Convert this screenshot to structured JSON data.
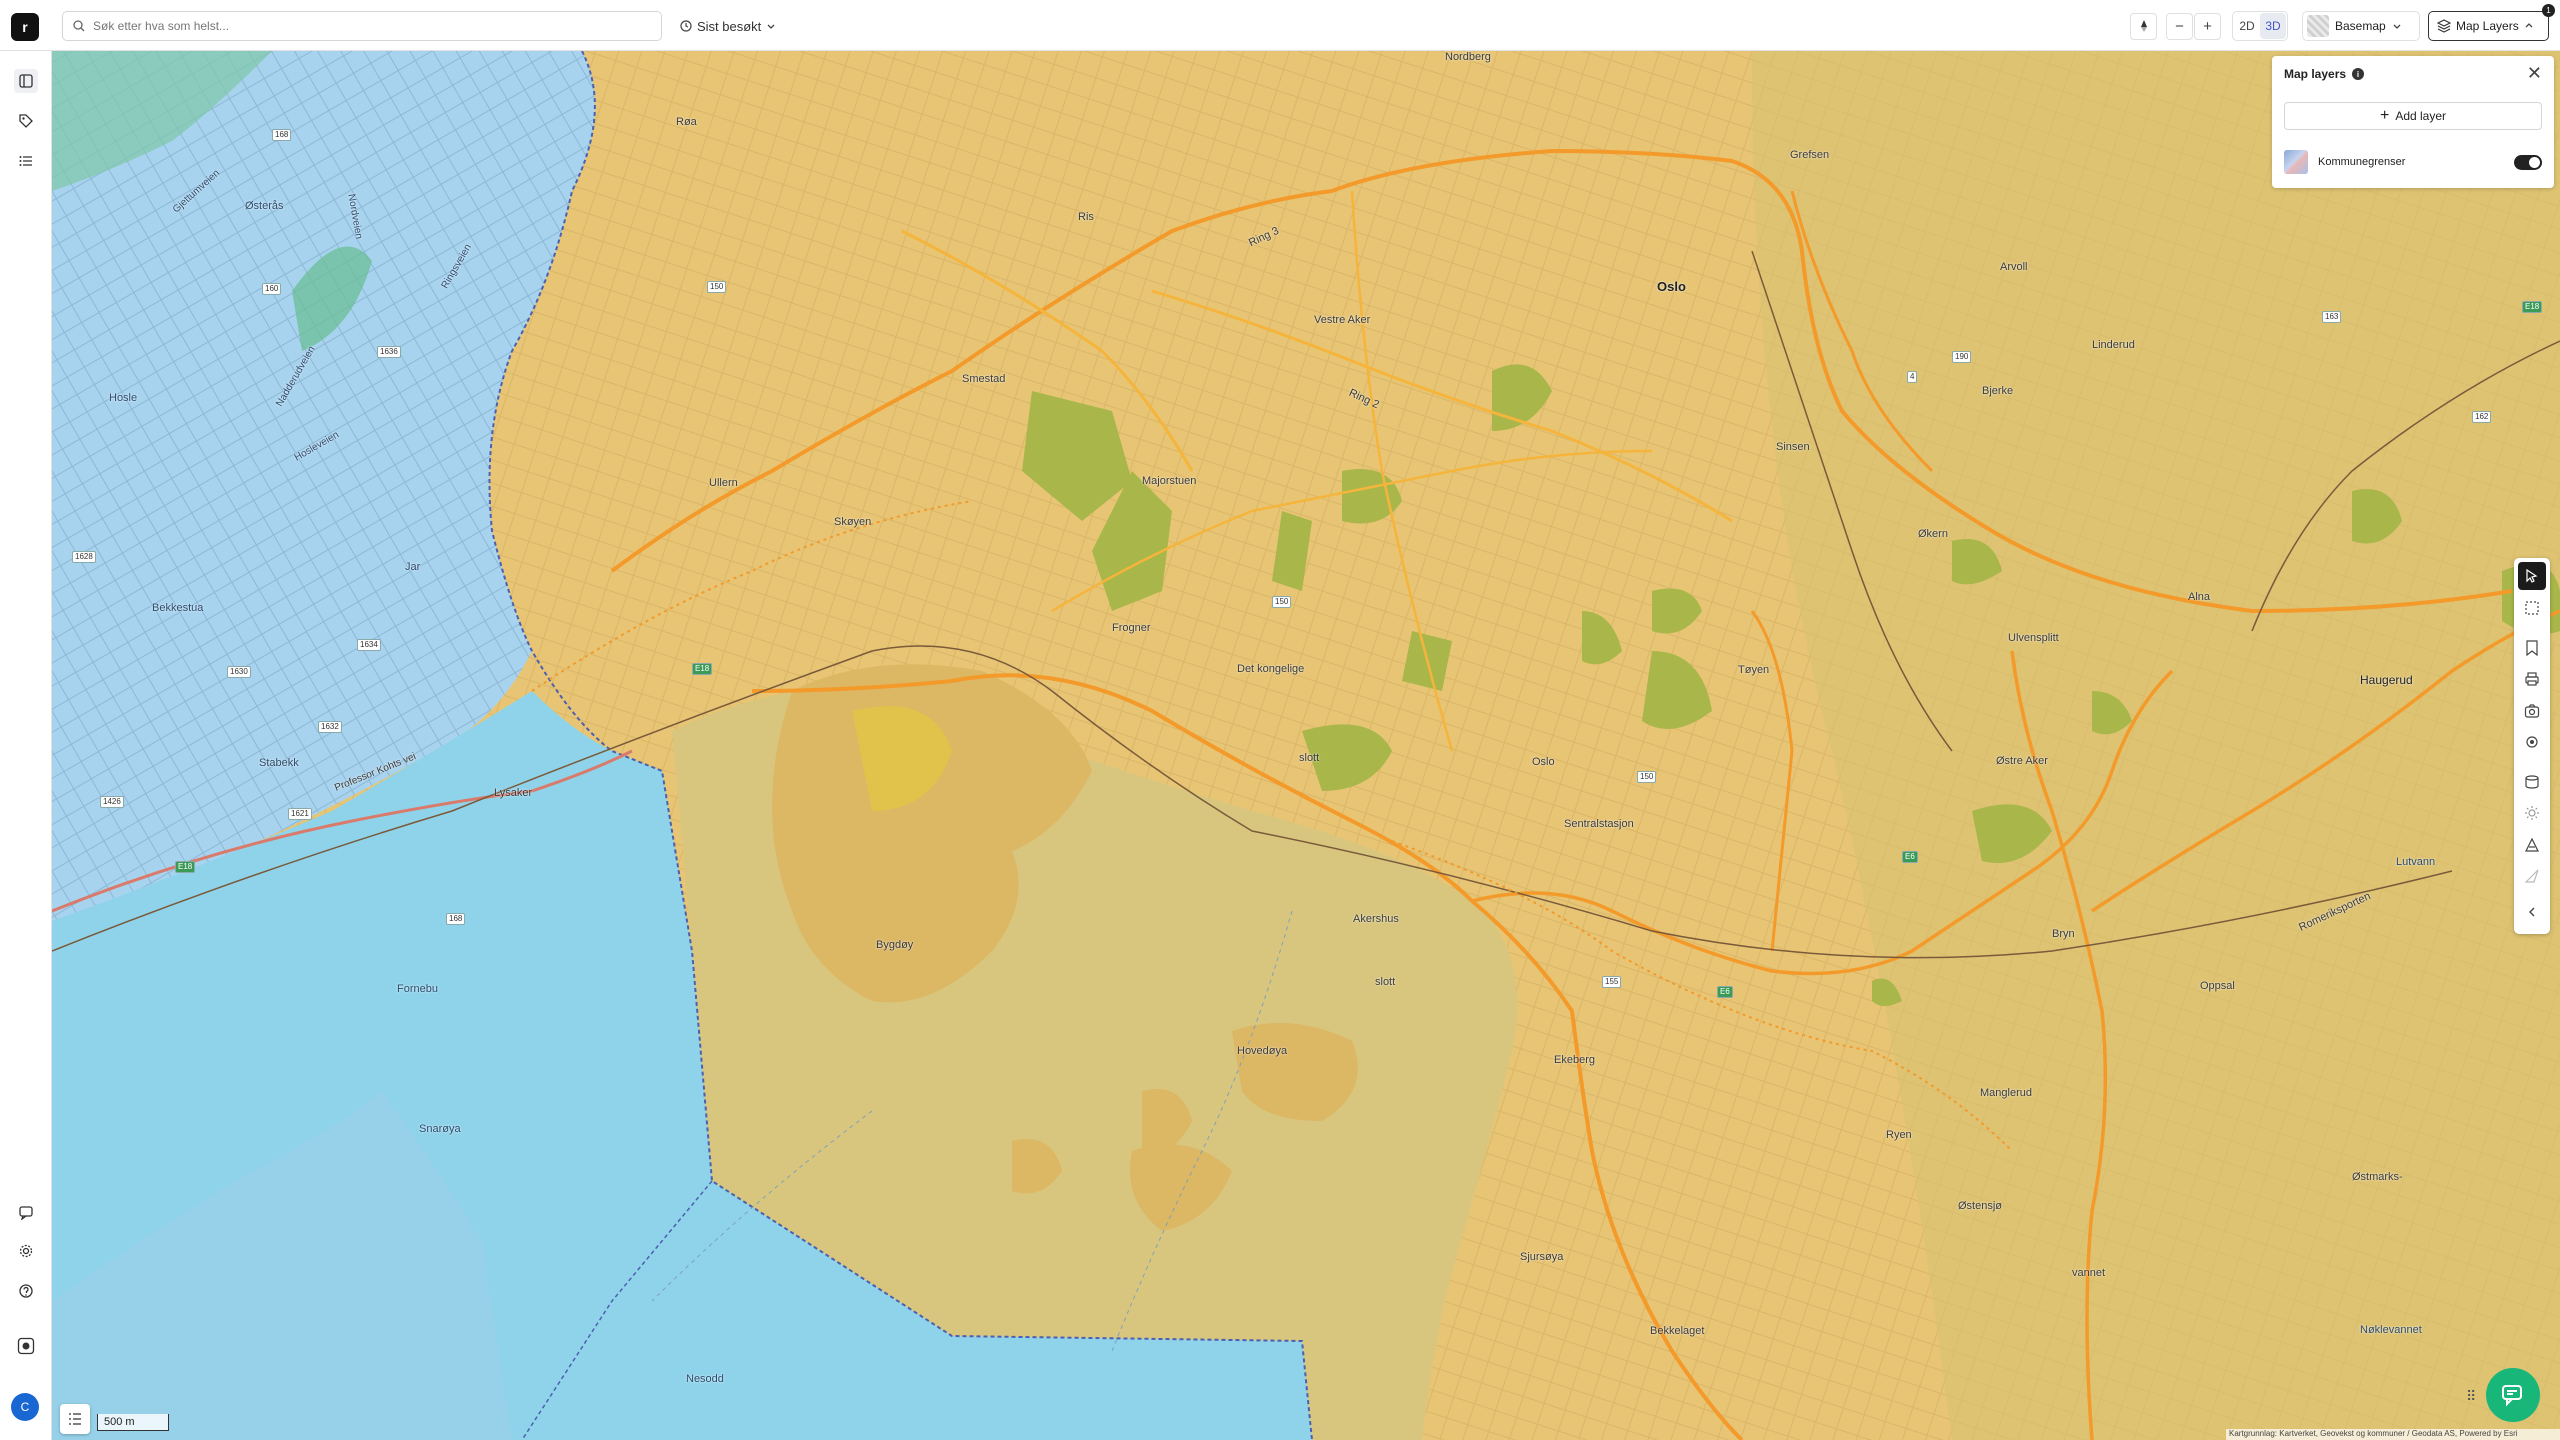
{
  "app": {
    "logo_text": "r"
  },
  "search": {
    "placeholder": "Søk etter hva som helst..."
  },
  "recent": {
    "label": "Sist besøkt"
  },
  "toolbar": {
    "view_2d": "2D",
    "view_3d": "3D",
    "active_view": "3D",
    "basemap_label": "Basemap",
    "maplayers_label": "Map Layers",
    "notification_count": "1"
  },
  "layers_panel": {
    "title": "Map layers",
    "add_label": "Add layer",
    "layers": [
      {
        "name": "Kommunegrenser",
        "visible": true
      }
    ]
  },
  "scale": {
    "label": "500 m"
  },
  "attribution": "Kartgrunnlag: Kartverket, Geovekst og kommuner / Geodata AS, Powered by Esri",
  "user": {
    "initial": "C"
  },
  "colors": {
    "land": "#e8c87a",
    "water": "#8fd3ea",
    "neighbor_municipality": "#a9d4ee",
    "parks": "#a9b64a",
    "roads": "#f39a2a"
  },
  "map": {
    "places": [
      {
        "name": "Nordberg"
      },
      {
        "name": "Grefsen"
      },
      {
        "name": "Oslo"
      },
      {
        "name": "Arvoll"
      },
      {
        "name": "Ring 3"
      },
      {
        "name": "Vestre Aker"
      },
      {
        "name": "Røa"
      },
      {
        "name": "Ris"
      },
      {
        "name": "Smestad"
      },
      {
        "name": "Ring 2"
      },
      {
        "name": "Linderud"
      },
      {
        "name": "Bjerke"
      },
      {
        "name": "Sinsen"
      },
      {
        "name": "Ullern"
      },
      {
        "name": "Skøyen"
      },
      {
        "name": "Majorstuen"
      },
      {
        "name": "Økern"
      },
      {
        "name": "Frogner"
      },
      {
        "name": "Alna"
      },
      {
        "name": "Ulvensplitt"
      },
      {
        "name": "Det kongelige"
      },
      {
        "name": "Tøyen"
      },
      {
        "name": "Haugerud"
      },
      {
        "name": "slott"
      },
      {
        "name": "Oslo"
      },
      {
        "name": "Østre Aker"
      },
      {
        "name": "Sentralstasjon"
      },
      {
        "name": "Akershus"
      },
      {
        "name": "slott"
      },
      {
        "name": "Bryn"
      },
      {
        "name": "Bygdøy"
      },
      {
        "name": "Oppsal"
      },
      {
        "name": "Hovedøya"
      },
      {
        "name": "Ekeberg"
      },
      {
        "name": "Manglerud"
      },
      {
        "name": "Ryen"
      },
      {
        "name": "Østensjø"
      },
      {
        "name": "Sjursøya"
      },
      {
        "name": "Nesodd"
      },
      {
        "name": "Bekkelaget"
      },
      {
        "name": "vannet"
      },
      {
        "name": "Nøklevannet"
      },
      {
        "name": "Romeriksporten"
      },
      {
        "name": "Lutvann"
      },
      {
        "name": "Østmarks-"
      },
      {
        "name": "Østerås"
      },
      {
        "name": "Hosle"
      },
      {
        "name": "Jar"
      },
      {
        "name": "Bekkestua"
      },
      {
        "name": "Stabekk"
      },
      {
        "name": "Lysaker"
      },
      {
        "name": "Fornebu"
      },
      {
        "name": "Snarøya"
      },
      {
        "name": "Professor Kohts vei"
      },
      {
        "name": "Gjettumveien"
      },
      {
        "name": "Nadderudveien"
      },
      {
        "name": "Nordveien"
      },
      {
        "name": "Ringsveien"
      },
      {
        "name": "Hosleveien"
      }
    ],
    "road_numbers": [
      "168",
      "1636",
      "160",
      "1628",
      "1634",
      "1630",
      "1632",
      "1426",
      "1621",
      "168",
      "E18",
      "E18",
      "150",
      "150",
      "150",
      "162",
      "4",
      "E6",
      "E6",
      "163",
      "190",
      "155",
      "E18"
    ]
  }
}
